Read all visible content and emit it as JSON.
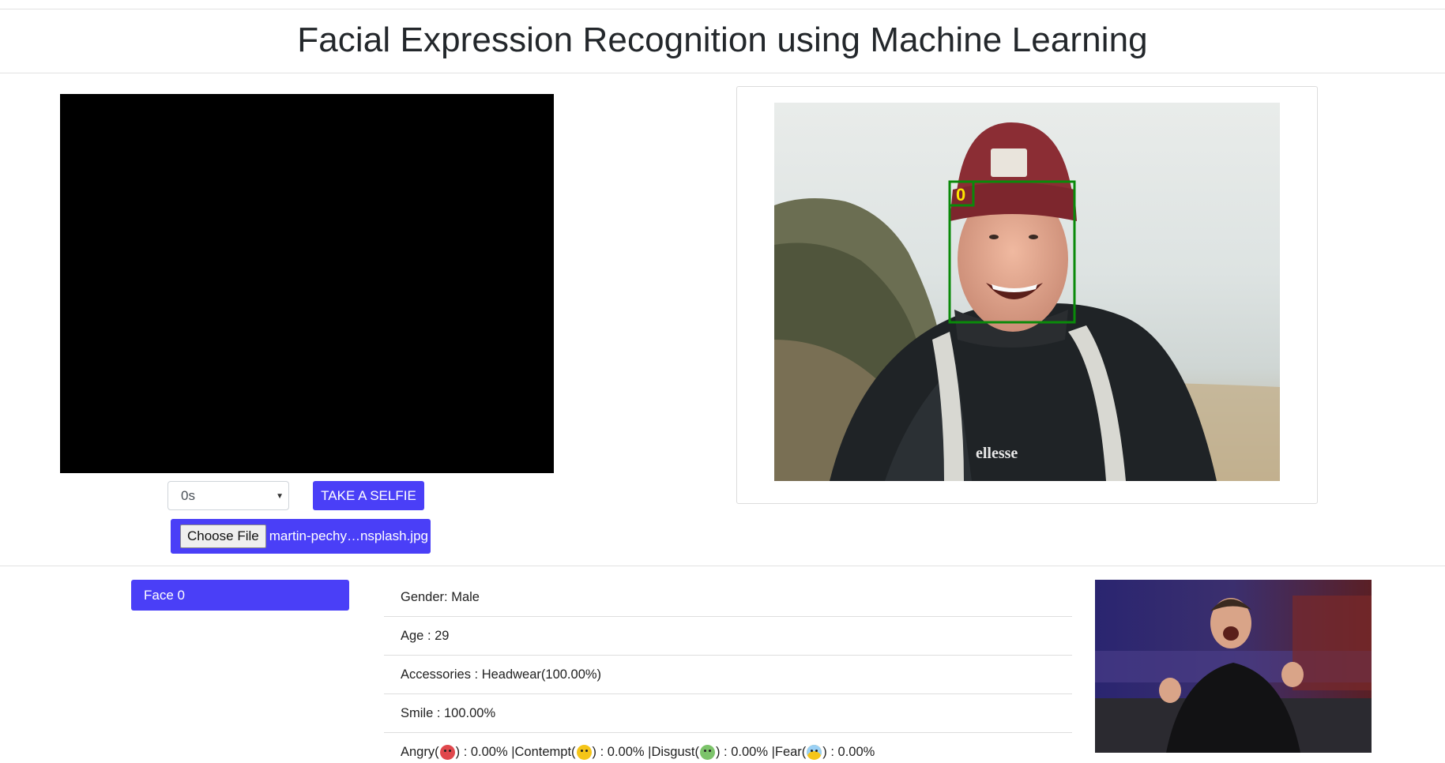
{
  "page": {
    "title": "Facial Expression Recognition using Machine Learning"
  },
  "capture": {
    "timer_value": "0s",
    "selfie_button": "TAKE A SELFIE",
    "choose_file_label": "Choose File",
    "file_name": "martin-pechy…nsplash.jpg"
  },
  "result": {
    "face_label": "0"
  },
  "faces": {
    "chip_label": "Face 0"
  },
  "details": {
    "gender": "Gender: Male",
    "age": "Age : 29",
    "accessories": "Accessories : Headwear(100.00%)",
    "smile": "Smile : 100.00%",
    "emotions": {
      "angry_label": "Angry(",
      "angry_value": ") : 0.00% | ",
      "contempt_label": "Contempt(",
      "contempt_value": ") : 0.00% | ",
      "disgust_label": "Disgust(",
      "disgust_value": ") : 0.00% | ",
      "fear_label": "Fear(",
      "fear_value": ") : 0.00%"
    }
  },
  "colors": {
    "primary": "#4a3ff7",
    "face_box": "#0a8a0a",
    "face_label": "#ffe600"
  }
}
